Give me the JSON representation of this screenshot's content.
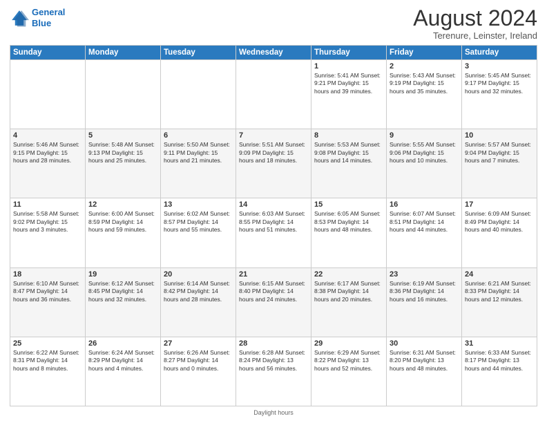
{
  "header": {
    "logo_line1": "General",
    "logo_line2": "Blue",
    "month_title": "August 2024",
    "subtitle": "Terenure, Leinster, Ireland"
  },
  "weekdays": [
    "Sunday",
    "Monday",
    "Tuesday",
    "Wednesday",
    "Thursday",
    "Friday",
    "Saturday"
  ],
  "weeks": [
    [
      {
        "day": "",
        "info": ""
      },
      {
        "day": "",
        "info": ""
      },
      {
        "day": "",
        "info": ""
      },
      {
        "day": "",
        "info": ""
      },
      {
        "day": "1",
        "info": "Sunrise: 5:41 AM\nSunset: 9:21 PM\nDaylight: 15 hours\nand 39 minutes."
      },
      {
        "day": "2",
        "info": "Sunrise: 5:43 AM\nSunset: 9:19 PM\nDaylight: 15 hours\nand 35 minutes."
      },
      {
        "day": "3",
        "info": "Sunrise: 5:45 AM\nSunset: 9:17 PM\nDaylight: 15 hours\nand 32 minutes."
      }
    ],
    [
      {
        "day": "4",
        "info": "Sunrise: 5:46 AM\nSunset: 9:15 PM\nDaylight: 15 hours\nand 28 minutes."
      },
      {
        "day": "5",
        "info": "Sunrise: 5:48 AM\nSunset: 9:13 PM\nDaylight: 15 hours\nand 25 minutes."
      },
      {
        "day": "6",
        "info": "Sunrise: 5:50 AM\nSunset: 9:11 PM\nDaylight: 15 hours\nand 21 minutes."
      },
      {
        "day": "7",
        "info": "Sunrise: 5:51 AM\nSunset: 9:09 PM\nDaylight: 15 hours\nand 18 minutes."
      },
      {
        "day": "8",
        "info": "Sunrise: 5:53 AM\nSunset: 9:08 PM\nDaylight: 15 hours\nand 14 minutes."
      },
      {
        "day": "9",
        "info": "Sunrise: 5:55 AM\nSunset: 9:06 PM\nDaylight: 15 hours\nand 10 minutes."
      },
      {
        "day": "10",
        "info": "Sunrise: 5:57 AM\nSunset: 9:04 PM\nDaylight: 15 hours\nand 7 minutes."
      }
    ],
    [
      {
        "day": "11",
        "info": "Sunrise: 5:58 AM\nSunset: 9:02 PM\nDaylight: 15 hours\nand 3 minutes."
      },
      {
        "day": "12",
        "info": "Sunrise: 6:00 AM\nSunset: 8:59 PM\nDaylight: 14 hours\nand 59 minutes."
      },
      {
        "day": "13",
        "info": "Sunrise: 6:02 AM\nSunset: 8:57 PM\nDaylight: 14 hours\nand 55 minutes."
      },
      {
        "day": "14",
        "info": "Sunrise: 6:03 AM\nSunset: 8:55 PM\nDaylight: 14 hours\nand 51 minutes."
      },
      {
        "day": "15",
        "info": "Sunrise: 6:05 AM\nSunset: 8:53 PM\nDaylight: 14 hours\nand 48 minutes."
      },
      {
        "day": "16",
        "info": "Sunrise: 6:07 AM\nSunset: 8:51 PM\nDaylight: 14 hours\nand 44 minutes."
      },
      {
        "day": "17",
        "info": "Sunrise: 6:09 AM\nSunset: 8:49 PM\nDaylight: 14 hours\nand 40 minutes."
      }
    ],
    [
      {
        "day": "18",
        "info": "Sunrise: 6:10 AM\nSunset: 8:47 PM\nDaylight: 14 hours\nand 36 minutes."
      },
      {
        "day": "19",
        "info": "Sunrise: 6:12 AM\nSunset: 8:45 PM\nDaylight: 14 hours\nand 32 minutes."
      },
      {
        "day": "20",
        "info": "Sunrise: 6:14 AM\nSunset: 8:42 PM\nDaylight: 14 hours\nand 28 minutes."
      },
      {
        "day": "21",
        "info": "Sunrise: 6:15 AM\nSunset: 8:40 PM\nDaylight: 14 hours\nand 24 minutes."
      },
      {
        "day": "22",
        "info": "Sunrise: 6:17 AM\nSunset: 8:38 PM\nDaylight: 14 hours\nand 20 minutes."
      },
      {
        "day": "23",
        "info": "Sunrise: 6:19 AM\nSunset: 8:36 PM\nDaylight: 14 hours\nand 16 minutes."
      },
      {
        "day": "24",
        "info": "Sunrise: 6:21 AM\nSunset: 8:33 PM\nDaylight: 14 hours\nand 12 minutes."
      }
    ],
    [
      {
        "day": "25",
        "info": "Sunrise: 6:22 AM\nSunset: 8:31 PM\nDaylight: 14 hours\nand 8 minutes."
      },
      {
        "day": "26",
        "info": "Sunrise: 6:24 AM\nSunset: 8:29 PM\nDaylight: 14 hours\nand 4 minutes."
      },
      {
        "day": "27",
        "info": "Sunrise: 6:26 AM\nSunset: 8:27 PM\nDaylight: 14 hours\nand 0 minutes."
      },
      {
        "day": "28",
        "info": "Sunrise: 6:28 AM\nSunset: 8:24 PM\nDaylight: 13 hours\nand 56 minutes."
      },
      {
        "day": "29",
        "info": "Sunrise: 6:29 AM\nSunset: 8:22 PM\nDaylight: 13 hours\nand 52 minutes."
      },
      {
        "day": "30",
        "info": "Sunrise: 6:31 AM\nSunset: 8:20 PM\nDaylight: 13 hours\nand 48 minutes."
      },
      {
        "day": "31",
        "info": "Sunrise: 6:33 AM\nSunset: 8:17 PM\nDaylight: 13 hours\nand 44 minutes."
      }
    ]
  ],
  "footer": {
    "daylight_label": "Daylight hours"
  }
}
